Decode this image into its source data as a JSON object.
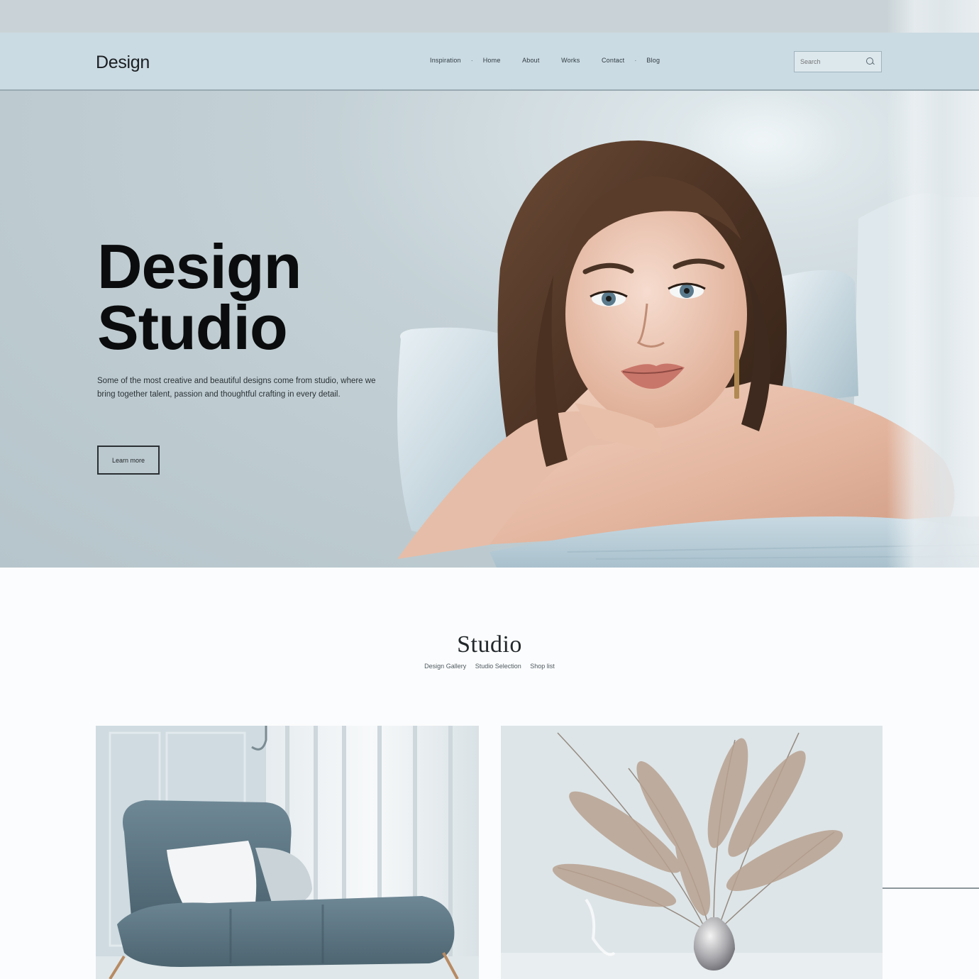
{
  "nav": {
    "logo": "Design",
    "links": [
      "Inspiration",
      "·",
      "Home",
      "About",
      "Works",
      "Contact",
      "·",
      "Blog"
    ],
    "search_placeholder": "Search"
  },
  "hero": {
    "title_line1": "Design",
    "title_line2": "Studio",
    "description": "Some of the most creative and beautiful designs come from studio, where we bring together talent, passion and thoughtful crafting in every detail.",
    "button_label": "Learn more"
  },
  "studio": {
    "title": "Studio",
    "tags": [
      "Design Gallery",
      "Studio Selection",
      "Shop list"
    ]
  },
  "colors": {
    "nav_bg": "#cbdbe3",
    "hero_bg": "#c4d1d6",
    "accent_dark": "#0b0c0d"
  }
}
